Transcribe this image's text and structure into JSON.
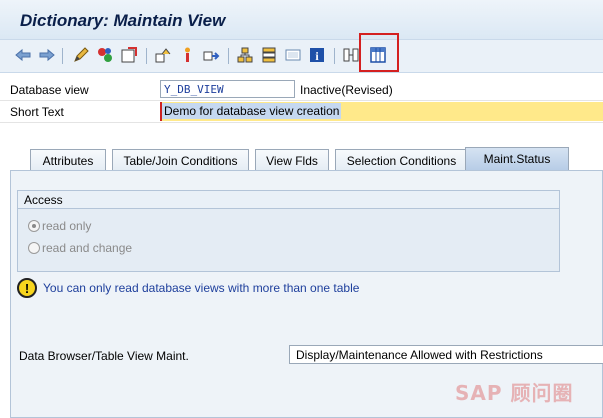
{
  "title": "Dictionary: Maintain View",
  "toolbar": {
    "icons": [
      "back-arrow-icon",
      "forward-arrow-icon",
      "edit-pencil-icon",
      "display-change-icon",
      "activate-icon",
      "where-used-icon",
      "object-list-icon",
      "navigate-icon",
      "hierarchy-icon",
      "layout-icon",
      "frame-icon",
      "info-icon",
      "table-grid-icon",
      "contents-icon"
    ]
  },
  "form": {
    "database_view_label": "Database view",
    "database_view_value": "Y_DB_VIEW",
    "database_view_status": "Inactive(Revised)",
    "short_text_label": "Short Text",
    "short_text_value": "Demo for database view creation"
  },
  "tabs": [
    {
      "label": "Attributes"
    },
    {
      "label": "Table/Join Conditions"
    },
    {
      "label": "View Flds"
    },
    {
      "label": "Selection Conditions"
    },
    {
      "label": "Maint.Status"
    }
  ],
  "active_tab": "Maint.Status",
  "access": {
    "header": "Access",
    "read_only": "read only",
    "read_and_change": "read and change",
    "selected": "read only"
  },
  "warning": {
    "icon": "warning-exclamation-icon",
    "text": "You can only read database views with more than one table"
  },
  "data_browser": {
    "label": "Data Browser/Table View Maint.",
    "value": "Display/Maintenance Allowed with Restrictions"
  },
  "watermark": "SAP 顾问圈"
}
